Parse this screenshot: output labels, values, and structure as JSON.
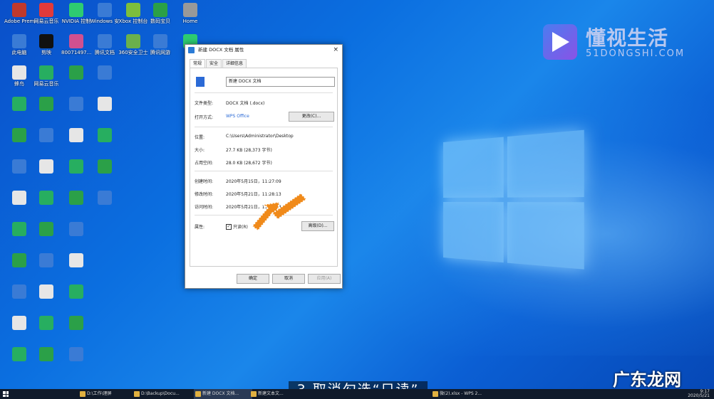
{
  "desktop": {
    "icons": [
      {
        "label": "Adobe Premier",
        "color": "#c0392b"
      },
      {
        "label": "网易云音乐",
        "color": "#e23a3a"
      },
      {
        "label": "NVIDIA 控制",
        "color": "#2ecc71"
      },
      {
        "label": "Windows 安",
        "color": "#3a7bd5"
      },
      {
        "label": "Xbox 控制台",
        "color": "#7dbe3c"
      },
      {
        "label": "数码宝贝",
        "color": "#2ba048"
      },
      {
        "label": "Home",
        "color": "#999"
      },
      {
        "label": "此电脑",
        "color": "#3a7bd5"
      },
      {
        "label": "剪映",
        "color": "#111"
      },
      {
        "label": "80071497...",
        "color": "#d05090"
      },
      {
        "label": "腾讯文档",
        "color": "#3a7bd5"
      },
      {
        "label": "360安全卫士",
        "color": "#6ab04c"
      },
      {
        "label": "腾讯网游",
        "color": "#3a7bd5"
      },
      {
        "label": "微信",
        "color": "#2ecc71"
      },
      {
        "label": "蜂鸟",
        "color": "#c0392b"
      },
      {
        "label": "网易云音乐",
        "color": "#e23a3a"
      }
    ]
  },
  "watermark": {
    "title": "懂视生活",
    "sub": "51DONGSHI.COM"
  },
  "dialog": {
    "title": "新建 DOCX 文档 属性",
    "close": "×",
    "tabs": [
      "常规",
      "安全",
      "详细信息"
    ],
    "filename": "新建 DOCX 文档",
    "rows": {
      "type_label": "文件类型:",
      "type_value": "DOCX 文档 (.docx)",
      "open_label": "打开方式:",
      "open_value": "WPS Office",
      "change_btn": "更改(C)...",
      "loc_label": "位置:",
      "loc_value": "C:\\Users\\Administrator\\Desktop",
      "size_label": "大小:",
      "size_value": "27.7 KB (28,373 字节)",
      "disk_label": "占用空间:",
      "disk_value": "28.0 KB (28,672 字节)",
      "created_label": "创建时间:",
      "created_value": "2020年5月15日，11:27:09",
      "modified_label": "修改时间:",
      "modified_value": "2020年5月21日，11:28:13",
      "accessed_label": "访问时间:",
      "accessed_value": "2020年5月21日，11:28:13",
      "attr_label": "属性:",
      "readonly_label": "只读(R)",
      "advanced_btn": "高级(D)..."
    },
    "buttons": {
      "ok": "确定",
      "cancel": "取消",
      "apply": "应用(A)"
    }
  },
  "subtitle": "3.取消勾选“只读”",
  "brand": "广东龙网",
  "taskbar": {
    "items": [
      "D:\\工作\\理屏",
      "D:\\Backup\\Docu...",
      "新建 DOCX 文档...",
      "新建文本文...",
      "微(2).xlsx - WPS 2..."
    ],
    "clock_time": "9:17",
    "clock_date": "2020/5/21"
  }
}
